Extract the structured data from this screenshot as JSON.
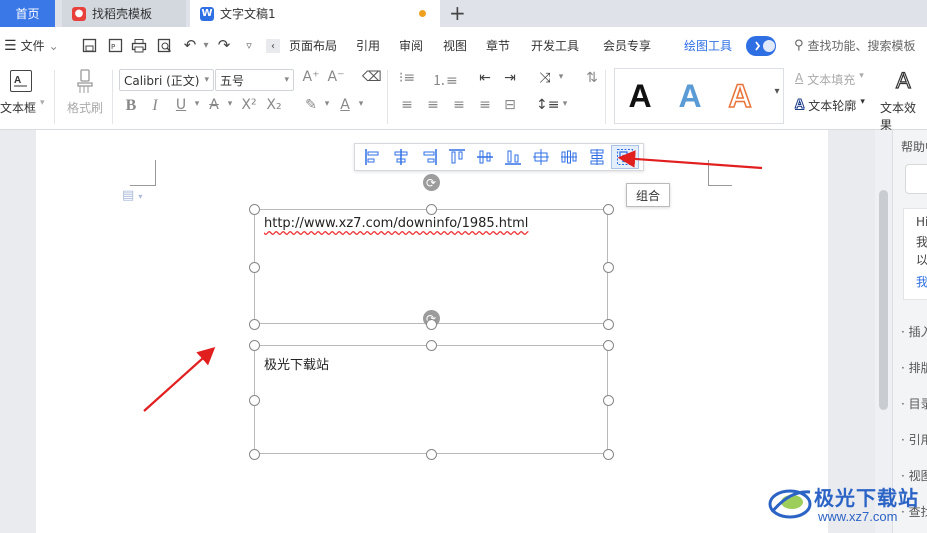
{
  "tabs": {
    "home": "首页",
    "template": "找稻壳模板",
    "doc": "文字文稿1",
    "add": "+"
  },
  "menu": {
    "file": "文件",
    "items": [
      "页面布局",
      "引用",
      "审阅",
      "视图",
      "章节",
      "开发工具",
      "会员专享",
      "绘图工具"
    ],
    "search": "查找功能、搜索模板"
  },
  "ribbon": {
    "textbox_label": "文本框",
    "format_painter": "格式刷",
    "font": "Calibri (正文)",
    "size": "五号",
    "text_fill": "文本填充",
    "text_outline": "文本轮廓",
    "text_effect": "文本效果",
    "style_letter": "A"
  },
  "colors": {
    "accent": "#2f6fe4",
    "style_outline_orange": "#e8733a",
    "style_blue": "#5b9bd5"
  },
  "document": {
    "textbox1": "http://www.xz7.com/downinfo/1985.html",
    "textbox2": "极光下载站",
    "tooltip": "组合"
  },
  "align_toolbar": {
    "icons": [
      "align-left-icon",
      "align-center-icon",
      "align-right-icon",
      "align-top-icon",
      "align-middle-icon",
      "align-bottom-icon",
      "distribute-horizontal-icon",
      "distribute-vertical-icon",
      "distribute-rows-icon",
      "group-icon"
    ],
    "selected": "group-icon"
  },
  "right_panel": {
    "title": "帮助中心",
    "card_lines": [
      "Hi",
      "我",
      "以",
      "我"
    ],
    "items": [
      "插入",
      "排版",
      "目录",
      "引用",
      "视图",
      "查找"
    ]
  },
  "watermark": {
    "title": "极光下载站",
    "url": "www.xz7.com"
  }
}
